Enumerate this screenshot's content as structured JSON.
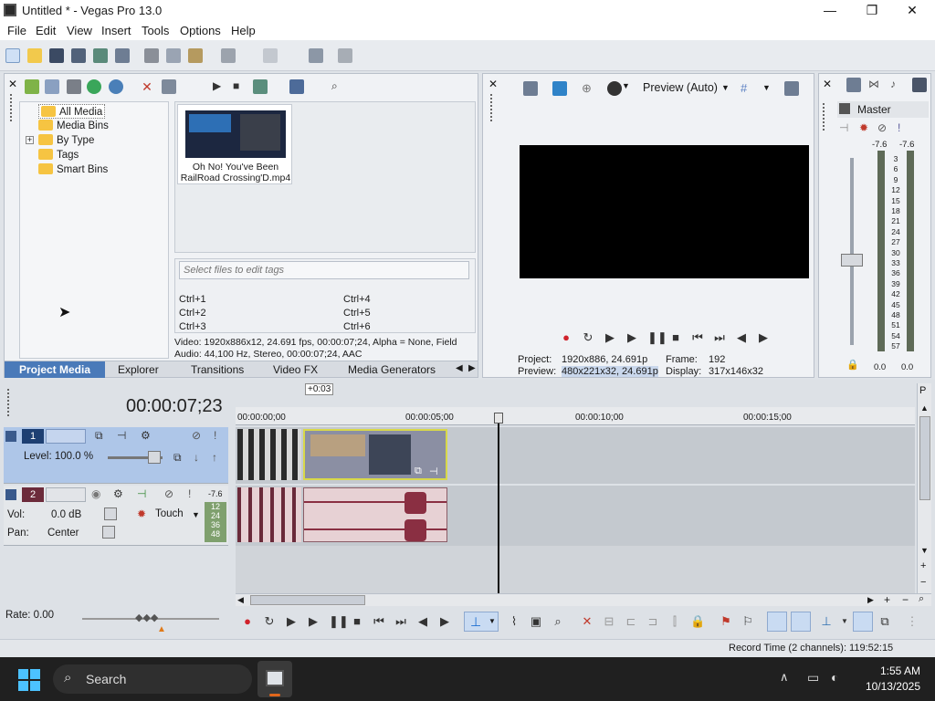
{
  "window": {
    "title": "Untitled * - Vegas Pro 13.0",
    "minimize": "—",
    "maximize": "❐",
    "close": "✕"
  },
  "menu": [
    "File",
    "Edit",
    "View",
    "Insert",
    "Tools",
    "Options",
    "Help"
  ],
  "explorer": {
    "tree": [
      "All Media",
      "Media Bins",
      "By Type",
      "Tags",
      "Smart Bins"
    ],
    "expand": "+",
    "media_item": "Oh No! You've Been RailRoad Crossing'D.mp4",
    "tags_placeholder": "Select files to edit tags",
    "shortcuts": [
      "Ctrl+1",
      "Ctrl+4",
      "Ctrl+2",
      "Ctrl+5",
      "Ctrl+3",
      "Ctrl+6"
    ],
    "video_info": "Video: 1920x886x12, 24.691 fps, 00:00:07;24, Alpha = None, Field",
    "audio_info": "Audio: 44,100 Hz, Stereo, 00:00:07;24, AAC",
    "tabs": [
      "Project Media",
      "Explorer",
      "Transitions",
      "Video FX",
      "Media Generators"
    ]
  },
  "preview": {
    "mode": "Preview (Auto)",
    "project_label": "Project:",
    "project_value": "1920x886, 24.691p",
    "frame_label": "Frame:",
    "frame_value": "192",
    "preview_label": "Preview:",
    "preview_value": "480x221x32, 24.691p",
    "display_label": "Display:",
    "display_value": "317x146x32"
  },
  "master": {
    "title": "Master",
    "peak_left": "-7.6",
    "peak_right": "-7.6",
    "scale": [
      "3",
      "6",
      "9",
      "12",
      "15",
      "18",
      "21",
      "24",
      "27",
      "30",
      "33",
      "36",
      "39",
      "42",
      "45",
      "48",
      "51",
      "54",
      "57"
    ],
    "fader_left": "0.0",
    "fader_right": "0.0",
    "level": 0.45
  },
  "timeline": {
    "timecode": "00:00:07;23",
    "offset": "+0:03",
    "ruler": [
      "00:00:00;00",
      "00:00:05;00",
      "00:00:10;00",
      "00:00:15;00"
    ],
    "track1": {
      "number": "1",
      "level": "Level: 100.0 %"
    },
    "track2": {
      "number": "2",
      "vol_label": "Vol:",
      "vol_value": "0.0 dB",
      "pan_label": "Pan:",
      "pan_value": "Center",
      "mode": "Touch",
      "meter_peak": "-7.6",
      "meter_scale": [
        "12",
        "24",
        "36",
        "48"
      ]
    },
    "rate": "Rate: 0.00"
  },
  "status": {
    "record_time": "Record Time (2 channels): 119:52:15"
  },
  "taskbar": {
    "search": "Search",
    "time": "1:55 AM",
    "date": "10/13/2025"
  },
  "colors": {
    "accent": "#1f6fd1",
    "clip_border": "#d8d84a",
    "record": "#d0222b"
  }
}
